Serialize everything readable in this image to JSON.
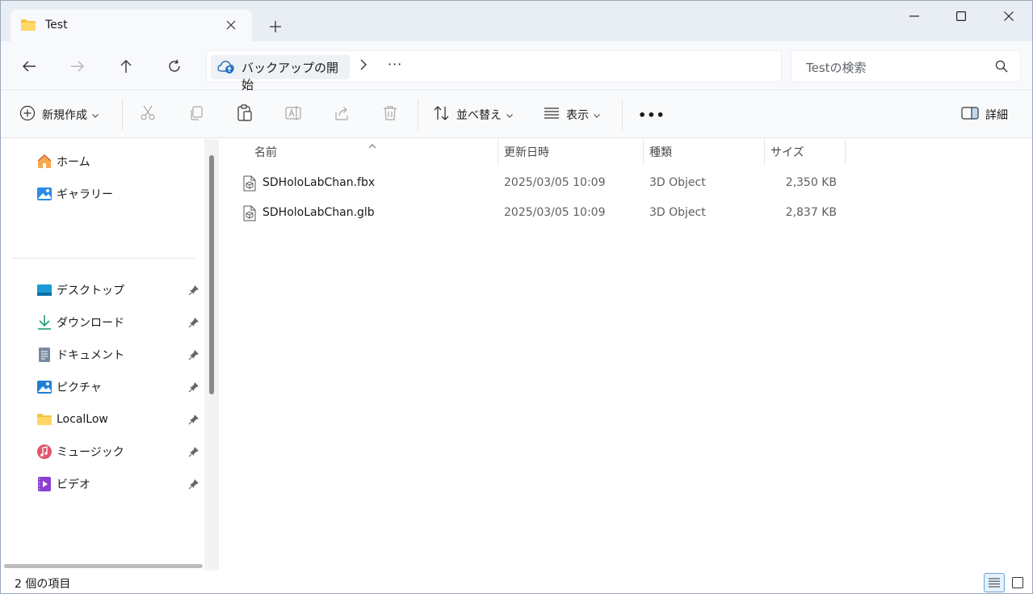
{
  "tab": {
    "title": "Test"
  },
  "address": {
    "crumb": "バックアップの開始",
    "more": "···"
  },
  "search": {
    "placeholder": "Testの検索"
  },
  "toolbar": {
    "new_label": "新規作成",
    "sort_label": "並べ替え",
    "view_label": "表示",
    "more_label": "•••",
    "details_label": "詳細"
  },
  "sidebar": {
    "top_items": [
      {
        "label": "ホーム",
        "icon": "home-icon"
      },
      {
        "label": "ギャラリー",
        "icon": "gallery-icon"
      }
    ],
    "pinned": [
      {
        "label": "デスクトップ",
        "icon": "desktop-icon"
      },
      {
        "label": "ダウンロード",
        "icon": "download-icon"
      },
      {
        "label": "ドキュメント",
        "icon": "documents-icon"
      },
      {
        "label": "ピクチャ",
        "icon": "pictures-icon"
      },
      {
        "label": "LocalLow",
        "icon": "folder-icon"
      },
      {
        "label": "ミュージック",
        "icon": "music-icon"
      },
      {
        "label": "ビデオ",
        "icon": "video-icon"
      }
    ]
  },
  "columns": {
    "name": "名前",
    "date": "更新日時",
    "type": "種類",
    "size": "サイズ"
  },
  "files": [
    {
      "name": "SDHoloLabChan.fbx",
      "date": "2025/03/05 10:09",
      "type": "3D Object",
      "size": "2,350 KB"
    },
    {
      "name": "SDHoloLabChan.glb",
      "date": "2025/03/05 10:09",
      "type": "3D Object",
      "size": "2,837 KB"
    }
  ],
  "status": {
    "count": "2 個の項目"
  },
  "colors": {
    "accent": "#0067c0",
    "folder": "#f5c342"
  }
}
